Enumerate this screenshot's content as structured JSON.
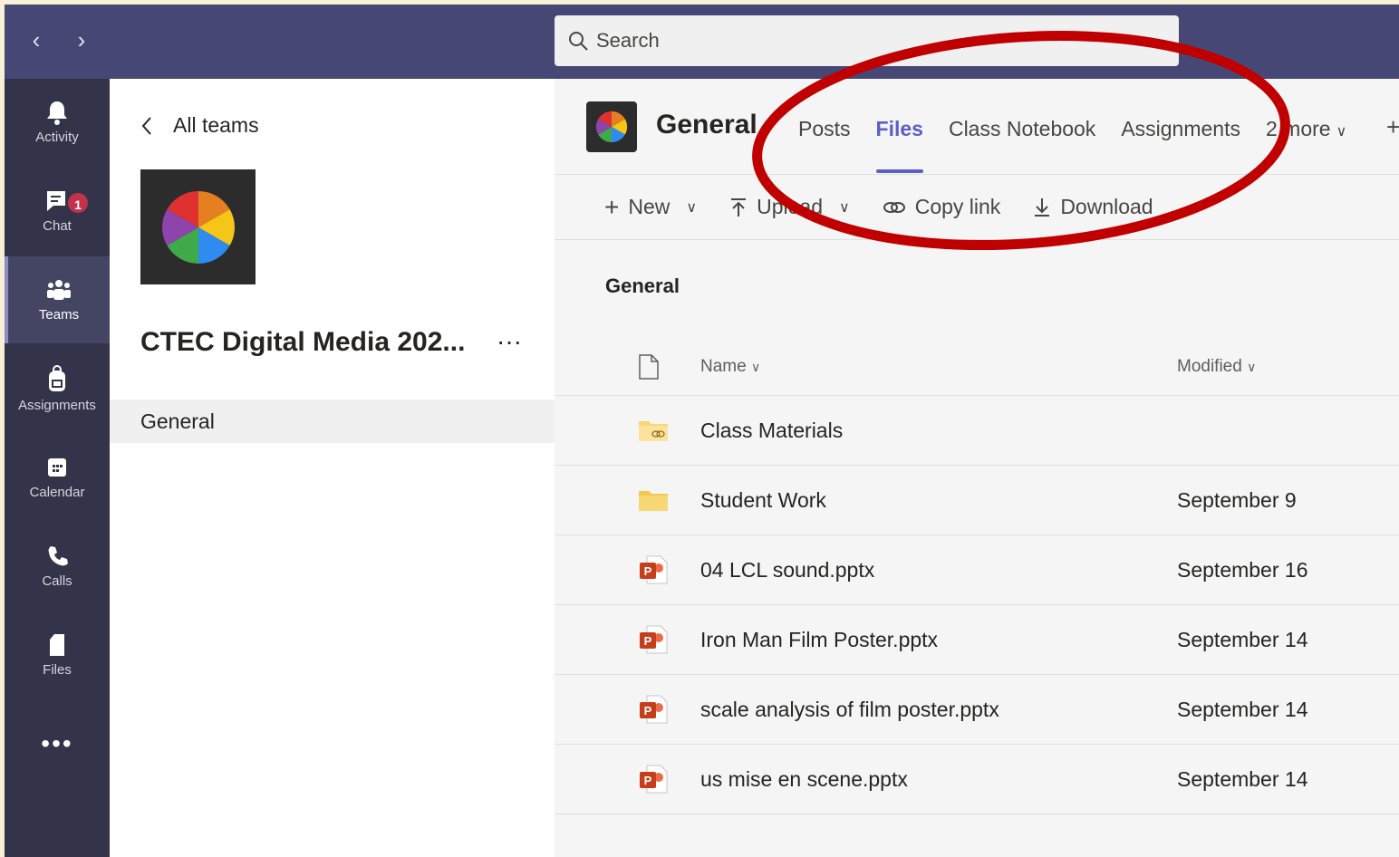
{
  "topbar": {
    "back_label": "‹",
    "forward_label": "›",
    "search_placeholder": "Search"
  },
  "rail": {
    "items": [
      {
        "label": "Activity",
        "icon": "bell-icon"
      },
      {
        "label": "Chat",
        "icon": "chat-icon",
        "badge": "1"
      },
      {
        "label": "Teams",
        "icon": "teams-icon",
        "active": true
      },
      {
        "label": "Assignments",
        "icon": "backpack-icon"
      },
      {
        "label": "Calendar",
        "icon": "calendar-icon"
      },
      {
        "label": "Calls",
        "icon": "phone-icon"
      },
      {
        "label": "Files",
        "icon": "file-icon"
      }
    ],
    "more_label": "•••"
  },
  "team": {
    "back_label": "All teams",
    "name": "CTEC Digital Media 202...",
    "more_label": "···",
    "channels": [
      "General"
    ]
  },
  "channel": {
    "title": "General",
    "tabs": [
      "Posts",
      "Files",
      "Class Notebook",
      "Assignments",
      "2 more"
    ],
    "active_tab": "Files",
    "add_tab": "+"
  },
  "toolbar": {
    "new_label": "New",
    "upload_label": "Upload",
    "copy_link_label": "Copy link",
    "download_label": "Download",
    "more_label": "···"
  },
  "files": {
    "folder_title": "General",
    "columns": {
      "name": "Name",
      "modified": "Modified"
    },
    "rows": [
      {
        "name": "Class Materials",
        "modified": "",
        "type": "folder-linked"
      },
      {
        "name": "Student Work",
        "modified": "September 9",
        "type": "folder"
      },
      {
        "name": "04 LCL sound.pptx",
        "modified": "September 16",
        "type": "pptx"
      },
      {
        "name": "Iron Man Film Poster.pptx",
        "modified": "September 14",
        "type": "pptx"
      },
      {
        "name": "scale analysis of film poster.pptx",
        "modified": "September 14",
        "type": "pptx"
      },
      {
        "name": "us mise en scene.pptx",
        "modified": "September 14",
        "type": "pptx"
      }
    ]
  },
  "colors": {
    "topbar": "#464775",
    "rail": "#33344a",
    "accent": "#5b5fc7",
    "annotation": "#c00000",
    "pptx": "#c43e1c",
    "folder": "#f8d775"
  }
}
